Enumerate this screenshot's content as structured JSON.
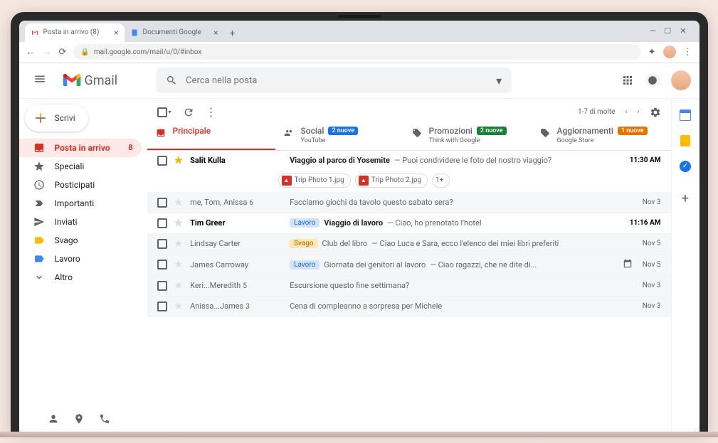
{
  "browser": {
    "tabs": [
      {
        "title": "Posta in arrivo (8)",
        "active": true
      },
      {
        "title": "Documenti Google",
        "active": false
      }
    ],
    "url": "mail.google.com/mail/u/0/#inbox"
  },
  "header": {
    "logo_text": "Gmail",
    "search_placeholder": "Cerca nella posta"
  },
  "compose": {
    "label": "Scrivi"
  },
  "sidebar": {
    "items": [
      {
        "icon": "inbox",
        "label": "Posta in arrivo",
        "count": "8",
        "active": true
      },
      {
        "icon": "star",
        "label": "Speciali"
      },
      {
        "icon": "clock",
        "label": "Posticipati"
      },
      {
        "icon": "important",
        "label": "Importanti"
      },
      {
        "icon": "send",
        "label": "Inviati"
      },
      {
        "icon": "tag",
        "label": "Svago",
        "color": "#fbbc04"
      },
      {
        "icon": "tag",
        "label": "Lavoro",
        "color": "#4285f4"
      },
      {
        "icon": "more",
        "label": "Altro"
      }
    ]
  },
  "toolbar": {
    "pagination": "1-7 di molte"
  },
  "categories": [
    {
      "icon": "inbox",
      "label": "Principale",
      "active": true
    },
    {
      "icon": "people",
      "label": "Social",
      "badge": "2 nuove",
      "badge_color": "blue",
      "sub": "YouTube"
    },
    {
      "icon": "tag",
      "label": "Promozioni",
      "badge": "2 nuove",
      "badge_color": "green",
      "sub": "Think with Google"
    },
    {
      "icon": "info",
      "label": "Aggiornamenti",
      "badge": "1 nuove",
      "badge_color": "orange",
      "sub": "Google Store"
    }
  ],
  "emails": [
    {
      "unread": true,
      "starred": true,
      "sender": "Salit Kulla",
      "subject": "Viaggio al parco di Yosemite",
      "snippet": "Puoi condividere le foto del nostro viaggio?",
      "time": "11:30 AM",
      "attachments": [
        "Trip Photo 1.jpg",
        "Trip Photo 2.jpg"
      ],
      "attachments_more": "1+"
    },
    {
      "sender": "me, Tom, Anissa",
      "sender_count": "6",
      "subject": "Facciamo giochi da tavolo questo sabato sera?",
      "time": "Nov 3"
    },
    {
      "unread": true,
      "sender": "Tim Greer",
      "label": "Lavoro",
      "label_type": "lavoro",
      "subject": "Viaggio di lavoro",
      "snippet": "Ciao, ho prenotato l'hotel",
      "time": "11:16 AM"
    },
    {
      "sender": "Lindsay Carter",
      "label": "Svago",
      "label_type": "svago",
      "subject": "Club del libro",
      "snippet": "Ciao Luca e Sara, ecco l'elenco dei miei libri preferiti",
      "time": "Nov 5"
    },
    {
      "sender": "James Carroway",
      "label": "Lavoro",
      "label_type": "lavoro",
      "subject": "Giornata dei genitori al lavoro",
      "snippet": "Ciao ragazzi, che ne dite di...",
      "time": "Nov 5",
      "calendar": true
    },
    {
      "sender": "Keri...Meredith",
      "sender_count": "5",
      "subject": "Escursione questo fine settimana?",
      "time": "Nov 3"
    },
    {
      "sender": "Anissa...James",
      "sender_count": "3",
      "subject": "Cena di compleanno a sorpresa per Michele",
      "time": "Nov 3"
    }
  ]
}
